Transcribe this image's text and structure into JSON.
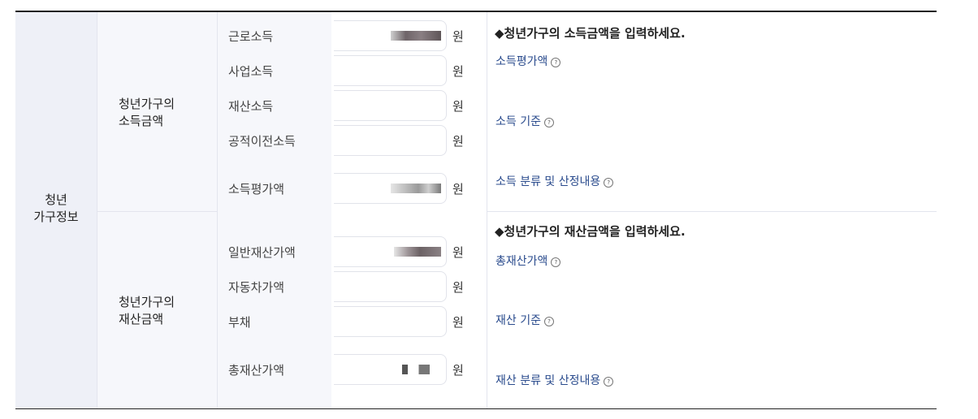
{
  "section": {
    "title": "청년\n가구정보"
  },
  "income": {
    "group_label": "청년가구의\n소득금액",
    "rows": [
      {
        "label": "근로소득",
        "unit": "원"
      },
      {
        "label": "사업소득",
        "unit": "원"
      },
      {
        "label": "재산소득",
        "unit": "원"
      },
      {
        "label": "공적이전소득",
        "unit": "원"
      },
      {
        "label": "소득평가액",
        "unit": "원"
      }
    ],
    "guide_title": "◆청년가구의 소득금액을 입력하세요.",
    "links": [
      {
        "label": "소득평가액",
        "icon": "help-circle-icon"
      },
      {
        "label": "소득 기준",
        "icon": "help-circle-icon"
      },
      {
        "label": "소득 분류 및 산정내용",
        "icon": "help-circle-icon"
      }
    ]
  },
  "assets": {
    "group_label": "청년가구의\n재산금액",
    "rows": [
      {
        "label": "일반재산가액",
        "unit": "원"
      },
      {
        "label": "자동차가액",
        "unit": "원"
      },
      {
        "label": "부채",
        "unit": "원"
      },
      {
        "label": "총재산가액",
        "unit": "원"
      }
    ],
    "guide_title": "◆청년가구의 재산금액을 입력하세요.",
    "links": [
      {
        "label": "총재산가액",
        "icon": "help-circle-icon"
      },
      {
        "label": "재산 기준",
        "icon": "help-circle-icon"
      },
      {
        "label": "재산 분류 및 산정내용",
        "icon": "help-circle-icon"
      }
    ]
  },
  "colors": {
    "header_bg": "#eef0f7",
    "link": "#2a4b8d",
    "border": "#e3e5ee"
  }
}
